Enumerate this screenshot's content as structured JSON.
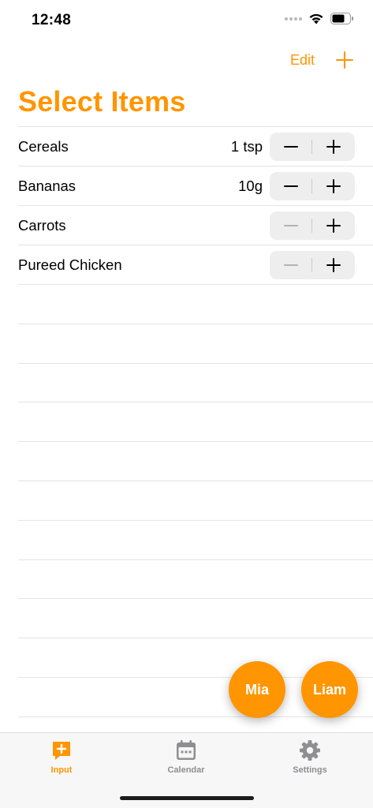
{
  "status_bar": {
    "time": "12:48"
  },
  "nav": {
    "edit_label": "Edit"
  },
  "page": {
    "title": "Select Items"
  },
  "items": [
    {
      "name": "Cereals",
      "amount": "1 tsp",
      "minus_enabled": true
    },
    {
      "name": "Bananas",
      "amount": "10g",
      "minus_enabled": true
    },
    {
      "name": "Carrots",
      "amount": "",
      "minus_enabled": false
    },
    {
      "name": "Pureed Chicken",
      "amount": "",
      "minus_enabled": false
    }
  ],
  "profiles": [
    {
      "name": "Mia"
    },
    {
      "name": "Liam"
    }
  ],
  "tabs": [
    {
      "label": "Input",
      "icon": "input-icon",
      "active": true
    },
    {
      "label": "Calendar",
      "icon": "calendar-icon",
      "active": false
    },
    {
      "label": "Settings",
      "icon": "gear-icon",
      "active": false
    }
  ],
  "colors": {
    "accent": "#ff9500",
    "inactive_tab": "#8e8e93",
    "stepper_bg": "#eeeeef",
    "separator": "#e4e4e4"
  }
}
